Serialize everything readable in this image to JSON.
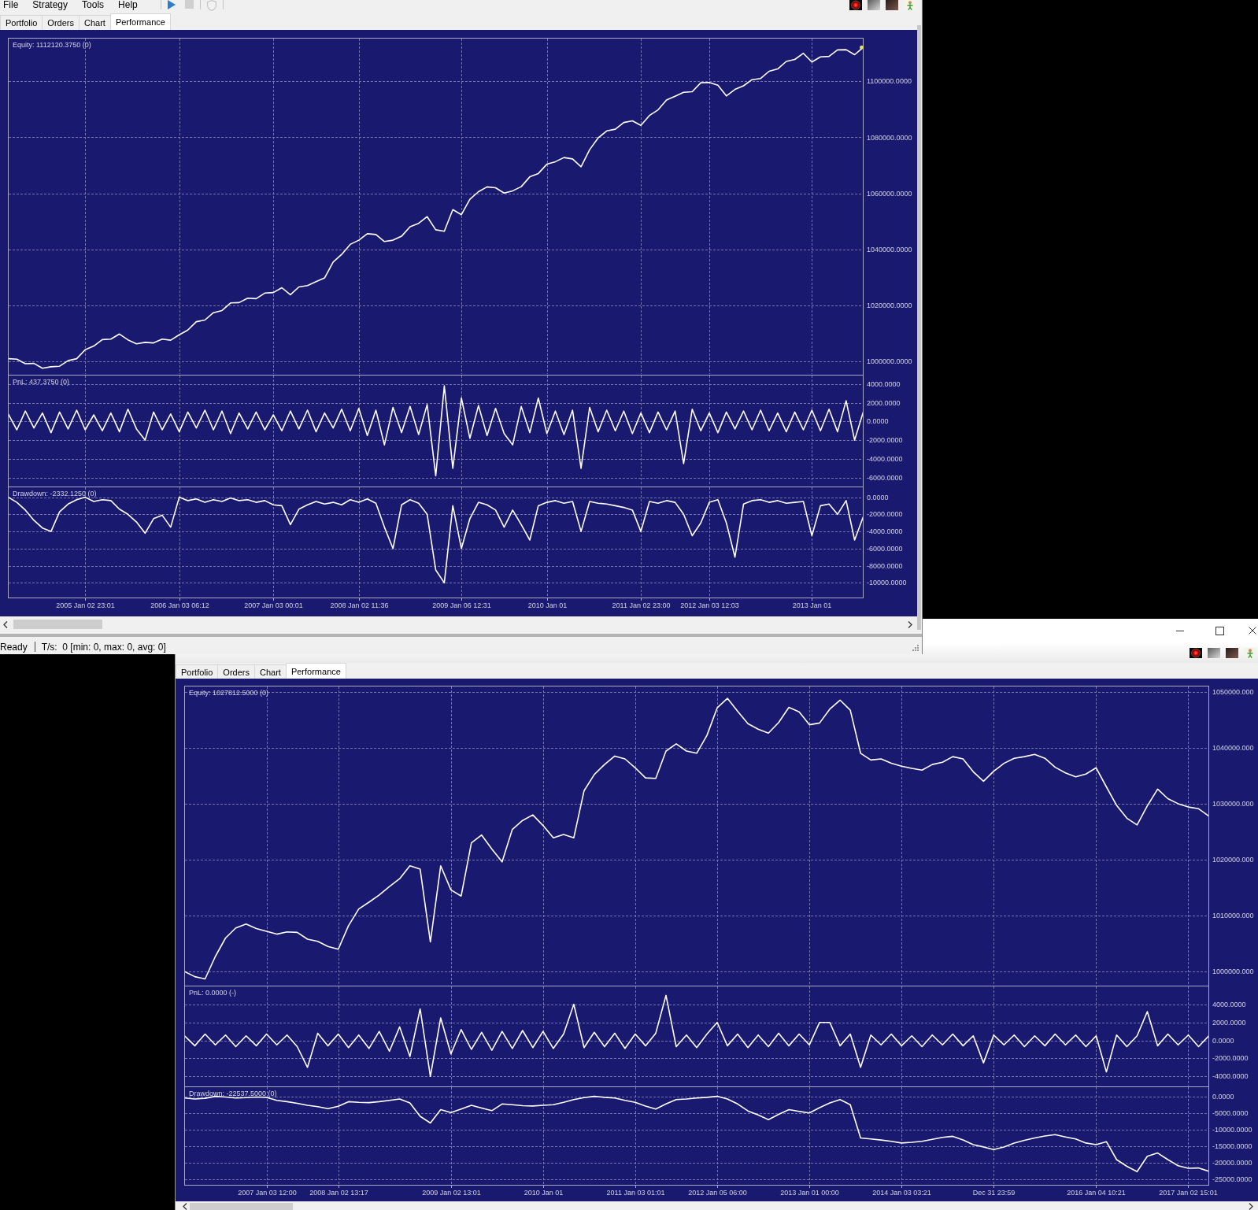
{
  "front_window": {
    "menu": [
      "File",
      "Strategy",
      "Tools",
      "Help"
    ],
    "toolbar": [
      {
        "disabled": false
      },
      {
        "disabled": true
      },
      {
        "disabled": true
      }
    ],
    "tabs": [
      {
        "label": "Portfolio",
        "selected": false
      },
      {
        "label": "Orders",
        "selected": false
      },
      {
        "label": "Chart",
        "selected": false
      },
      {
        "label": "Performance",
        "selected": true
      }
    ],
    "panes": [
      {
        "last_point_marker": true,
        "chart_data": {
          "type": "line",
          "title": "Equity: 1112120.3750 (0)",
          "grid": true,
          "categories": [
            null,
            null,
            null,
            null,
            null,
            null,
            null,
            null,
            null,
            null,
            null,
            null,
            null,
            null,
            null,
            null,
            null,
            null,
            null,
            null,
            null,
            null,
            null,
            null,
            null,
            null,
            null,
            null,
            null,
            null,
            null,
            null,
            null,
            null,
            null,
            null,
            null,
            null,
            null,
            null,
            null,
            null,
            null,
            null,
            null,
            null,
            null,
            null,
            null,
            null,
            null,
            null,
            null,
            null,
            null,
            null,
            null,
            null,
            null,
            null,
            null,
            null,
            null,
            null,
            null,
            null,
            null,
            null,
            null,
            null,
            null,
            null,
            null,
            null,
            null,
            null,
            null,
            null,
            null,
            null,
            null,
            null,
            null,
            null,
            null,
            null,
            null,
            null,
            null,
            null,
            null,
            null,
            null,
            null,
            null,
            null,
            null,
            null,
            null,
            null,
            null
          ],
          "values": [
            1001000,
            1000800,
            999200,
            999300,
            997600,
            998100,
            998300,
            1000300,
            1001000,
            1004200,
            1005500,
            1007800,
            1008000,
            1009800,
            1007700,
            1006300,
            1006800,
            1006600,
            1008000,
            1007600,
            1009500,
            1011200,
            1014200,
            1014800,
            1017400,
            1018200,
            1020900,
            1021000,
            1022600,
            1022400,
            1024400,
            1024600,
            1026300,
            1023800,
            1026600,
            1027100,
            1028500,
            1029800,
            1035500,
            1038200,
            1041800,
            1043300,
            1045600,
            1045300,
            1042800,
            1043300,
            1044700,
            1048100,
            1049300,
            1051700,
            1047000,
            1046500,
            1054200,
            1052400,
            1057900,
            1060600,
            1062300,
            1062000,
            1060100,
            1060900,
            1062400,
            1065900,
            1067100,
            1070400,
            1071300,
            1072800,
            1072300,
            1069500,
            1075600,
            1079800,
            1082300,
            1082900,
            1085300,
            1085900,
            1084300,
            1087800,
            1089800,
            1093300,
            1094700,
            1096100,
            1096300,
            1099500,
            1099600,
            1098600,
            1094800,
            1097100,
            1098400,
            1100600,
            1101000,
            1103600,
            1104400,
            1107100,
            1107800,
            1110000,
            1106900,
            1108700,
            1108900,
            1111200,
            1111300,
            1109500,
            1112100
          ],
          "ylim": [
            995400,
            1115400
          ],
          "yticks": [
            {
              "value": 1100000,
              "label": "1100000.0000"
            },
            {
              "value": 1080000,
              "label": "1080000.0000"
            },
            {
              "value": 1060000,
              "label": "1060000.0000"
            },
            {
              "value": 1040000,
              "label": "1040000.0000"
            },
            {
              "value": 1020000,
              "label": "1020000.0000"
            },
            {
              "value": 1000000,
              "label": "1000000.0000"
            }
          ]
        }
      },
      {
        "last_point_marker": false,
        "chart_data": {
          "type": "line",
          "title": "PnL: 437.3750 (0)",
          "grid": true,
          "categories": [
            null,
            null,
            null,
            null,
            null,
            null,
            null,
            null,
            null,
            null,
            null,
            null,
            null,
            null,
            null,
            null,
            null,
            null,
            null,
            null,
            null,
            null,
            null,
            null,
            null,
            null,
            null,
            null,
            null,
            null,
            null,
            null,
            null,
            null,
            null,
            null,
            null,
            null,
            null,
            null,
            null,
            null,
            null,
            null,
            null,
            null,
            null,
            null,
            null,
            null,
            null,
            null,
            null,
            null,
            null,
            null,
            null,
            null,
            null,
            null,
            null,
            null,
            null,
            null,
            null,
            null,
            null,
            null,
            null,
            null,
            null,
            null,
            null,
            null,
            null,
            null,
            null,
            null,
            null,
            null,
            null,
            null,
            null,
            null,
            null,
            null,
            null,
            null,
            null,
            null,
            null,
            null,
            null,
            null,
            null,
            null,
            null,
            null,
            null,
            null,
            null
          ],
          "values": [
            800,
            -900,
            1100,
            -700,
            900,
            -1200,
            1000,
            -800,
            1200,
            -900,
            700,
            -1000,
            900,
            -1100,
            1300,
            -800,
            -2000,
            1000,
            -900,
            800,
            -1100,
            1000,
            -700,
            1200,
            -900,
            1100,
            -1300,
            900,
            -800,
            1000,
            -900,
            700,
            -1000,
            1100,
            -800,
            1200,
            -1100,
            900,
            -700,
            1300,
            -1000,
            1400,
            -1500,
            1200,
            -2500,
            1500,
            -1200,
            1600,
            -1400,
            1800,
            -5800,
            3800,
            -5000,
            2500,
            -1800,
            1700,
            -1500,
            1400,
            -1300,
            -2500,
            1600,
            -1200,
            2500,
            -1300,
            1100,
            -1400,
            1200,
            -5000,
            1500,
            -1100,
            1200,
            -1000,
            1100,
            -1300,
            900,
            -1200,
            1000,
            -900,
            1100,
            -4500,
            1300,
            -1000,
            900,
            -1200,
            1000,
            -800,
            1100,
            -900,
            1200,
            -1000,
            900,
            -1100,
            1000,
            -900,
            1200,
            -1000,
            1300,
            -1100,
            2200,
            -2000,
            1000
          ],
          "ylim": [
            -6900,
            4940
          ],
          "yticks": [
            {
              "value": 4000,
              "label": "4000.0000"
            },
            {
              "value": 2000,
              "label": "2000.0000"
            },
            {
              "value": 0,
              "label": "0.0000"
            },
            {
              "value": -2000,
              "label": "-2000.0000"
            },
            {
              "value": -4000,
              "label": "-4000.0000"
            },
            {
              "value": -6000,
              "label": "-6000.0000"
            }
          ]
        }
      },
      {
        "last_point_marker": false,
        "chart_data": {
          "type": "line",
          "title": "Drawdown: -2332.1250 (0)",
          "grid": true,
          "categories": [
            null,
            null,
            null,
            null,
            null,
            null,
            null,
            null,
            null,
            "2005 Jan 02 23:01",
            null,
            null,
            null,
            null,
            null,
            null,
            null,
            null,
            null,
            null,
            "2006 Jan 03 06:12",
            null,
            null,
            null,
            null,
            null,
            null,
            null,
            null,
            null,
            null,
            "2007 Jan 03 00:01",
            null,
            null,
            null,
            null,
            null,
            null,
            null,
            null,
            null,
            "2008 Jan 02 11:36",
            null,
            null,
            null,
            null,
            null,
            null,
            null,
            null,
            null,
            null,
            null,
            "2009 Jan 06 12:31",
            null,
            null,
            null,
            null,
            null,
            null,
            null,
            null,
            null,
            "2010 Jan 01",
            null,
            null,
            null,
            null,
            null,
            null,
            null,
            null,
            null,
            null,
            "2011 Jan 02 23:00",
            null,
            null,
            null,
            null,
            null,
            null,
            null,
            "2012 Jan 03 12:03",
            null,
            null,
            null,
            null,
            null,
            null,
            null,
            null,
            null,
            null,
            null,
            "2013 Jan 01",
            null,
            null,
            null,
            null,
            null,
            null
          ],
          "values": [
            0,
            -600,
            -1500,
            -2700,
            -3600,
            -4000,
            -1700,
            -800,
            -300,
            0,
            -500,
            -300,
            -400,
            -1400,
            -2000,
            -2900,
            -4200,
            -2500,
            -2100,
            -3500,
            0,
            -400,
            -200,
            -600,
            -300,
            -500,
            -100,
            -400,
            -300,
            -600,
            -400,
            -900,
            -1000,
            -3200,
            -1400,
            -900,
            -500,
            -800,
            -600,
            -900,
            -300,
            -600,
            -200,
            -700,
            -3500,
            -6000,
            -900,
            -300,
            -700,
            -2000,
            -8500,
            -10000,
            -1000,
            -6000,
            -2500,
            -600,
            -900,
            -1500,
            -3500,
            -1500,
            -3200,
            -5000,
            -1000,
            -600,
            -400,
            -700,
            -500,
            -4000,
            -500,
            -700,
            -800,
            -1000,
            -1200,
            -1500,
            -4000,
            -500,
            -700,
            -400,
            -600,
            -2000,
            -4500,
            -3000,
            -600,
            -300,
            -3000,
            -7000,
            -800,
            -400,
            -300,
            -600,
            -400,
            -700,
            -600,
            -500,
            -4500,
            -1000,
            -800,
            -2000,
            -400,
            -5000,
            -2300
          ],
          "ylim": [
            -11760,
            1200
          ],
          "yticks": [
            {
              "value": 0,
              "label": "0.0000"
            },
            {
              "value": -2000,
              "label": "-2000.0000"
            },
            {
              "value": -4000,
              "label": "-4000.0000"
            },
            {
              "value": -6000,
              "label": "-6000.0000"
            },
            {
              "value": -8000,
              "label": "-8000.0000"
            },
            {
              "value": -10000,
              "label": "-10000.0000"
            }
          ]
        }
      }
    ],
    "status_bar": {
      "message": "Ready",
      "rate": "T/s:  0 [min: 0, max: 0, avg: 0]"
    }
  },
  "back_window": {
    "tabs": [
      {
        "label": "Portfolio",
        "selected": false
      },
      {
        "label": "Orders",
        "selected": false
      },
      {
        "label": "Chart",
        "selected": false
      },
      {
        "label": "Performance",
        "selected": true
      }
    ],
    "panes": [
      {
        "last_point_marker": false,
        "chart_data": {
          "type": "line",
          "title": "Equity: 1027812.5000 (0)",
          "grid": true,
          "categories": [
            null,
            null,
            null,
            null,
            null,
            null,
            null,
            null,
            null,
            null,
            null,
            null,
            null,
            null,
            null,
            null,
            null,
            null,
            null,
            null,
            null,
            null,
            null,
            null,
            null,
            null,
            null,
            null,
            null,
            null,
            null,
            null,
            null,
            null,
            null,
            null,
            null,
            null,
            null,
            null,
            null,
            null,
            null,
            null,
            null,
            null,
            null,
            null,
            null,
            null,
            null,
            null,
            null,
            null,
            null,
            null,
            null,
            null,
            null,
            null,
            null,
            null,
            null,
            null,
            null,
            null,
            null,
            null,
            null,
            null,
            null,
            null,
            null,
            null,
            null,
            null,
            null,
            null,
            null,
            null,
            null,
            null,
            null,
            null,
            null,
            null,
            null,
            null,
            null,
            null,
            null,
            null,
            null,
            null,
            null,
            null,
            null,
            null,
            null,
            null,
            null
          ],
          "values": [
            1000000,
            999100,
            998700,
            1002700,
            1006000,
            1007800,
            1008500,
            1007700,
            1007200,
            1006700,
            1007100,
            1007000,
            1005800,
            1005400,
            1004500,
            1004000,
            1008200,
            1011200,
            1012400,
            1013700,
            1015200,
            1016600,
            1018900,
            1018300,
            1005300,
            1018900,
            1014600,
            1013500,
            1023000,
            1024400,
            1021900,
            1019600,
            1025400,
            1027000,
            1028000,
            1026100,
            1023900,
            1024500,
            1023900,
            1032300,
            1035200,
            1037000,
            1038500,
            1038000,
            1036400,
            1034600,
            1034500,
            1039400,
            1040700,
            1039400,
            1039000,
            1042200,
            1047100,
            1048800,
            1046500,
            1044300,
            1043300,
            1042600,
            1044500,
            1047200,
            1046400,
            1044100,
            1044400,
            1046900,
            1048500,
            1046700,
            1039000,
            1037800,
            1038000,
            1037200,
            1036700,
            1036300,
            1036000,
            1037000,
            1037400,
            1038400,
            1038000,
            1035700,
            1034000,
            1035800,
            1037200,
            1038100,
            1038400,
            1038800,
            1038100,
            1036500,
            1035500,
            1034800,
            1035300,
            1036400,
            1033000,
            1029700,
            1027400,
            1026200,
            1029600,
            1032600,
            1030900,
            1030000,
            1029400,
            1029100,
            1027800
          ],
          "ylim": [
            997570,
            1051000
          ],
          "yticks": [
            {
              "value": 1050000,
              "label": "1050000.000"
            },
            {
              "value": 1040000,
              "label": "1040000.000"
            },
            {
              "value": 1030000,
              "label": "1030000.000"
            },
            {
              "value": 1020000,
              "label": "1020000.000"
            },
            {
              "value": 1010000,
              "label": "1010000.000"
            },
            {
              "value": 1000000,
              "label": "1000000.000"
            }
          ]
        }
      },
      {
        "last_point_marker": false,
        "chart_data": {
          "type": "line",
          "title": "PnL: 0.0000 (-)",
          "grid": true,
          "categories": [
            null,
            null,
            null,
            null,
            null,
            null,
            null,
            null,
            null,
            null,
            null,
            null,
            null,
            null,
            null,
            null,
            null,
            null,
            null,
            null,
            null,
            null,
            null,
            null,
            null,
            null,
            null,
            null,
            null,
            null,
            null,
            null,
            null,
            null,
            null,
            null,
            null,
            null,
            null,
            null,
            null,
            null,
            null,
            null,
            null,
            null,
            null,
            null,
            null,
            null,
            null,
            null,
            null,
            null,
            null,
            null,
            null,
            null,
            null,
            null,
            null,
            null,
            null,
            null,
            null,
            null,
            null,
            null,
            null,
            null,
            null,
            null,
            null,
            null,
            null,
            null,
            null,
            null,
            null,
            null,
            null,
            null,
            null,
            null,
            null,
            null,
            null,
            null,
            null,
            null,
            null,
            null,
            null,
            null,
            null,
            null,
            null,
            null,
            null,
            null,
            null
          ],
          "values": [
            500,
            -600,
            700,
            -500,
            600,
            -700,
            500,
            -600,
            700,
            -500,
            600,
            -700,
            -3000,
            800,
            -600,
            700,
            -800,
            600,
            -900,
            1000,
            -1200,
            1500,
            -1800,
            3500,
            -4000,
            2500,
            -1500,
            1200,
            -1000,
            900,
            -1100,
            1000,
            -900,
            1100,
            -800,
            1000,
            -900,
            700,
            4000,
            -800,
            900,
            -700,
            800,
            -900,
            700,
            -600,
            800,
            5000,
            -700,
            600,
            -800,
            700,
            2000,
            -600,
            700,
            -800,
            600,
            -700,
            800,
            -600,
            700,
            -500,
            2000,
            2000,
            -600,
            700,
            -3000,
            600,
            -500,
            700,
            -600,
            500,
            -700,
            600,
            -500,
            700,
            -600,
            500,
            -2500,
            600,
            -500,
            600,
            -700,
            500,
            -600,
            700,
            -500,
            600,
            -700,
            500,
            -3500,
            600,
            -700,
            500,
            3200,
            -600,
            700,
            -500,
            600,
            -700,
            500
          ],
          "ylim": [
            -5070,
            6040
          ],
          "yticks": [
            {
              "value": 4000,
              "label": "4000.0000"
            },
            {
              "value": 2000,
              "label": "2000.0000"
            },
            {
              "value": 0,
              "label": "0.0000"
            },
            {
              "value": -2000,
              "label": "-2000.0000"
            },
            {
              "value": -4000,
              "label": "-4000.0000"
            }
          ]
        }
      },
      {
        "last_point_marker": false,
        "chart_data": {
          "type": "line",
          "title": "Drawdown: -22537.5000 (0)",
          "grid": true,
          "categories": [
            null,
            null,
            null,
            null,
            null,
            null,
            null,
            null,
            "2007 Jan 03 12:00",
            null,
            null,
            null,
            null,
            null,
            null,
            "2008 Jan 02 13:17",
            null,
            null,
            null,
            null,
            null,
            null,
            null,
            null,
            null,
            null,
            "2009 Jan 02 13:01",
            null,
            null,
            null,
            null,
            null,
            null,
            null,
            null,
            "2010 Jan 01",
            null,
            null,
            null,
            null,
            null,
            null,
            null,
            null,
            "2011 Jan 03 01:01",
            null,
            null,
            null,
            null,
            null,
            null,
            null,
            "2012 Jan 05 06:00",
            null,
            null,
            null,
            null,
            null,
            null,
            null,
            null,
            "2013 Jan 01 00:00",
            null,
            null,
            null,
            null,
            null,
            null,
            null,
            null,
            "2014 Jan 03 03:21",
            null,
            null,
            null,
            null,
            null,
            null,
            null,
            null,
            "Dec 31 23:59",
            null,
            null,
            null,
            null,
            null,
            null,
            null,
            null,
            null,
            "2016 Jan 04 10:21",
            null,
            null,
            null,
            null,
            null,
            null,
            null,
            null,
            "2017 Jan 02 15:01",
            null,
            null
          ],
          "values": [
            -500,
            -800,
            -600,
            0,
            -200,
            -500,
            -400,
            -200,
            -300,
            -1200,
            -1600,
            -2100,
            -2700,
            -3100,
            -3700,
            -3000,
            -1600,
            -1800,
            -1900,
            -1600,
            -1200,
            -800,
            -2000,
            -6000,
            -8000,
            -4000,
            -4900,
            -3800,
            -2700,
            -3500,
            -4300,
            -2300,
            -2500,
            -2800,
            -2900,
            -2700,
            -2500,
            -1800,
            -1000,
            -400,
            0,
            -300,
            -500,
            -1200,
            -1800,
            -2900,
            -3800,
            -2300,
            -1000,
            -800,
            -500,
            -300,
            0,
            -800,
            -2300,
            -4400,
            -5600,
            -7000,
            -5400,
            -4000,
            -4500,
            -5000,
            -3400,
            -2000,
            -1000,
            -2500,
            -12500,
            -12800,
            -13100,
            -13500,
            -14000,
            -13800,
            -13500,
            -12900,
            -12300,
            -12000,
            -13100,
            -14500,
            -15200,
            -16000,
            -15200,
            -14000,
            -13200,
            -12500,
            -11900,
            -11500,
            -12200,
            -12800,
            -14000,
            -14500,
            -13600,
            -19000,
            -21000,
            -22600,
            -18000,
            -17000,
            -19000,
            -20800,
            -21600,
            -21500,
            -22500
          ],
          "ylim": [
            -26670,
            2860
          ],
          "yticks": [
            {
              "value": 0,
              "label": "0.0000"
            },
            {
              "value": -5000,
              "label": "-5000.0000"
            },
            {
              "value": -10000,
              "label": "-10000.0000"
            },
            {
              "value": -15000,
              "label": "-15000.0000"
            },
            {
              "value": -20000,
              "label": "-20000.0000"
            },
            {
              "value": -25000,
              "label": "-25000.0000"
            }
          ]
        }
      }
    ]
  }
}
